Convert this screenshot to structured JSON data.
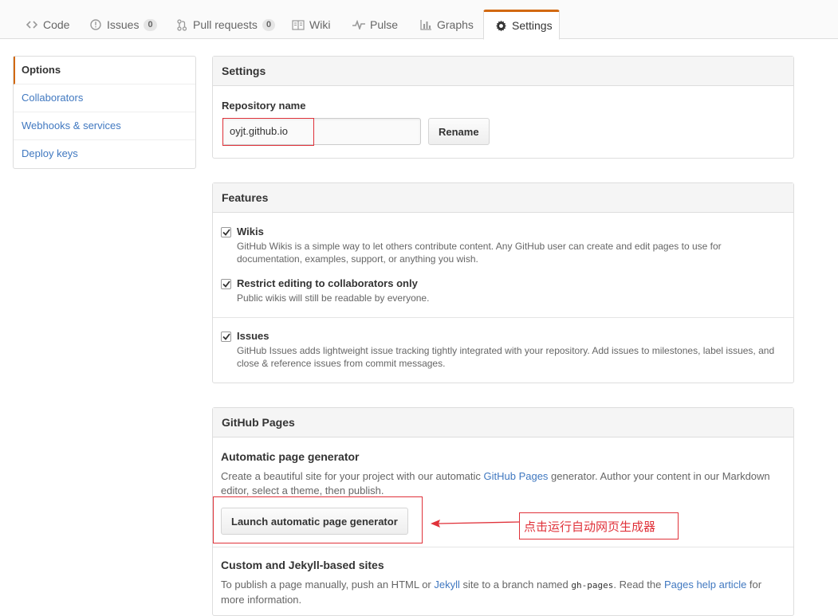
{
  "tabs": [
    {
      "label": "Code",
      "icon": "code-icon"
    },
    {
      "label": "Issues",
      "count": "0",
      "icon": "issue-opened-icon"
    },
    {
      "label": "Pull requests",
      "count": "0",
      "icon": "git-pull-request-icon"
    },
    {
      "label": "Wiki",
      "icon": "book-icon"
    },
    {
      "label": "Pulse",
      "icon": "pulse-icon"
    },
    {
      "label": "Graphs",
      "icon": "graph-icon"
    },
    {
      "label": "Settings",
      "icon": "gear-icon",
      "selected": true
    }
  ],
  "sidebar": {
    "items": [
      {
        "label": "Options",
        "selected": true
      },
      {
        "label": "Collaborators"
      },
      {
        "label": "Webhooks & services"
      },
      {
        "label": "Deploy keys"
      }
    ]
  },
  "settings": {
    "title": "Settings",
    "repo_name_label": "Repository name",
    "repo_name_value": "oyjt.github.io",
    "rename_button": "Rename"
  },
  "features": {
    "title": "Features",
    "options": [
      {
        "title": "Wikis",
        "checked": true,
        "desc_1": "GitHub Wikis is a simple way to let others contribute content. Any GitHub user can create and edit pages to use for",
        "desc_2": "documentation, examples, support, or anything you wish."
      },
      {
        "title": "Restrict editing to collaborators only",
        "checked": true,
        "desc_1": "Public wikis will still be readable by everyone."
      },
      {
        "title": "Issues",
        "checked": true,
        "desc_1": "GitHub Issues adds lightweight issue tracking tightly integrated with your repository. Add issues to milestones, label issues, and",
        "desc_2": "close & reference issues from commit messages."
      }
    ]
  },
  "pages": {
    "title": "GitHub Pages",
    "auto_heading": "Automatic page generator",
    "auto_text_1": "Create a beautiful site for your project with our automatic ",
    "auto_link": "GitHub Pages",
    "auto_text_2": " generator. Author your content in our Markdown",
    "auto_text_3": "editor, select a theme, then publish.",
    "launch_button": "Launch automatic page generator",
    "custom_heading": "Custom and Jekyll-based sites",
    "custom_text_1": "To publish a page manually, push an HTML or ",
    "custom_link_jekyll": "Jekyll",
    "custom_text_2": " site to a branch named ",
    "custom_code": "gh-pages",
    "custom_text_3": ". Read the ",
    "custom_link_help": "Pages help article",
    "custom_text_4": " for",
    "custom_text_5": "more information."
  },
  "annotation": {
    "text": "点击运行自动网页生成器",
    "color": "#e0323a"
  },
  "colors": {
    "accent": "#d26911",
    "link": "#4078c0"
  }
}
